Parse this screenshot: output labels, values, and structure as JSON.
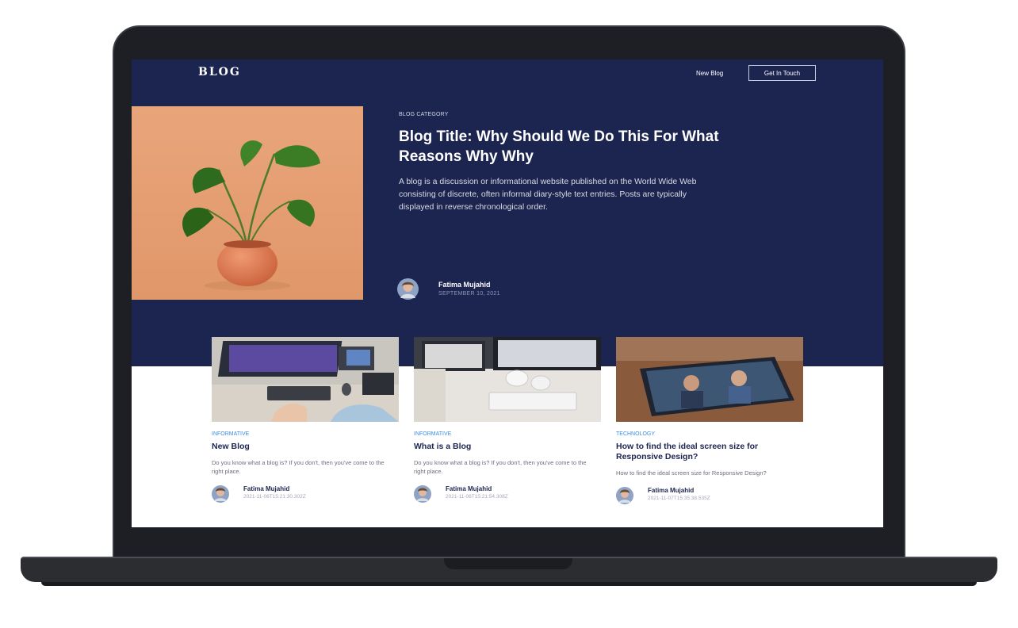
{
  "nav": {
    "logo": "BLOG",
    "new_blog": "New Blog",
    "get_in_touch": "Get In Touch"
  },
  "hero": {
    "category": "BLOG CATEGORY",
    "title": "Blog Title: Why Should We Do This For What Reasons Why Why",
    "description": "A blog is a discussion or informational website published on the World Wide Web consisting of discrete, often informal diary-style text entries. Posts are typically displayed in reverse chronological order.",
    "author": "Fatima Mujahid",
    "date": "SEPTEMBER 10, 2021",
    "image_icon": "monstera-plant-photo"
  },
  "cards": [
    {
      "category": "INFORMATIVE",
      "title": "New Blog",
      "description": "Do you know what a blog is? If you don't, then you've come to the right place.",
      "author": "Fatima Mujahid",
      "date": "2021-11-06T15:21:30.302Z",
      "image_icon": "desk-setup-photo"
    },
    {
      "category": "INFORMATIVE",
      "title": "What is a Blog",
      "description": "Do you know what a blog is? If you don't, then you've come to the right place.",
      "author": "Fatima Mujahid",
      "date": "2021-11-06T15:21:54.308Z",
      "image_icon": "keyboard-mugs-photo"
    },
    {
      "category": "TECHNOLOGY",
      "title": "How to find the ideal screen size for Responsive Design?",
      "description": "How to find the ideal screen size for Responsive Design?",
      "author": "Fatima Mujahid",
      "date": "2021-11-07T15:35:38.535Z",
      "image_icon": "tablet-video-call-photo"
    }
  ],
  "colors": {
    "hero_background": "#1c2450",
    "category_accent": "#3b8de0",
    "laptop_frame": "#1d1f24"
  }
}
